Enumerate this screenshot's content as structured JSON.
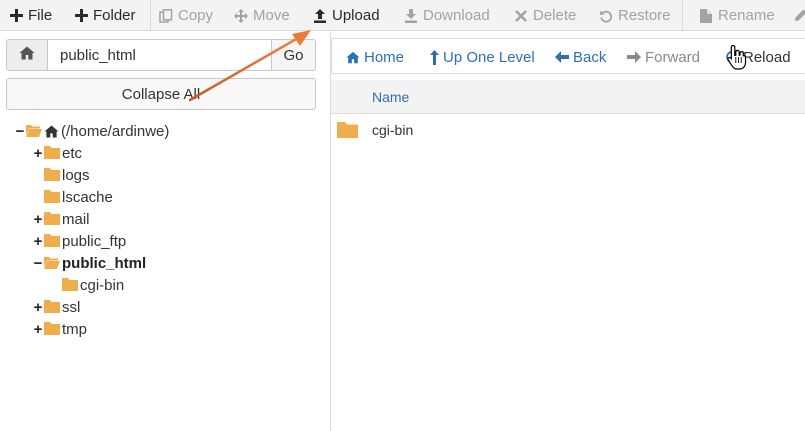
{
  "toolbar": {
    "file": "File",
    "folder": "Folder",
    "copy": "Copy",
    "move": "Move",
    "upload": "Upload",
    "download": "Download",
    "delete": "Delete",
    "restore": "Restore",
    "rename": "Rename"
  },
  "path": {
    "value": "public_html",
    "go": "Go",
    "collapse_all": "Collapse All"
  },
  "tree": {
    "root": "(/home/ardinwe)",
    "items": [
      {
        "label": "etc",
        "toggle": "+"
      },
      {
        "label": "logs",
        "toggle": ""
      },
      {
        "label": "lscache",
        "toggle": ""
      },
      {
        "label": "mail",
        "toggle": "+"
      },
      {
        "label": "public_ftp",
        "toggle": "+"
      },
      {
        "label": "public_html",
        "toggle": "−"
      },
      {
        "label": "cgi-bin",
        "toggle": ""
      },
      {
        "label": "ssl",
        "toggle": "+"
      },
      {
        "label": "tmp",
        "toggle": "+"
      }
    ]
  },
  "nav": {
    "home": "Home",
    "up": "Up One Level",
    "back": "Back",
    "forward": "Forward",
    "reload": "Reload"
  },
  "list": {
    "col_name": "Name",
    "rows": [
      {
        "name": "cgi-bin"
      }
    ]
  },
  "colors": {
    "accent_blue": "#2e6fb4",
    "folder_orange": "#f0ad4e",
    "annotation_arrow": "#e8703a"
  }
}
